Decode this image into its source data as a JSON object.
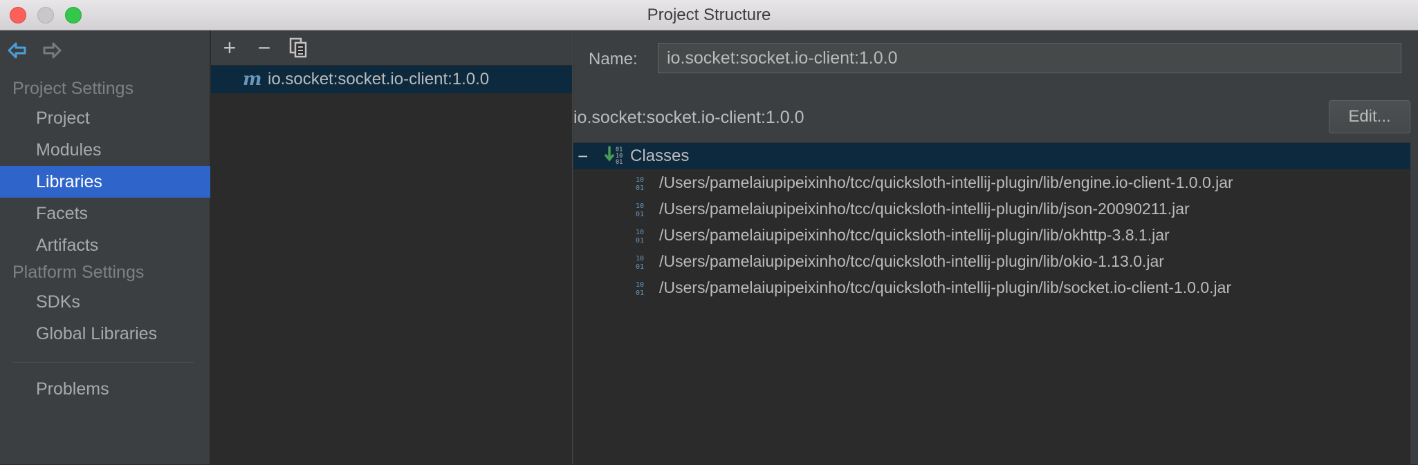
{
  "window": {
    "title": "Project Structure"
  },
  "sidebar": {
    "sections": [
      {
        "header": "Project Settings",
        "items": [
          "Project",
          "Modules",
          "Libraries",
          "Facets",
          "Artifacts"
        ]
      },
      {
        "header": "Platform Settings",
        "items": [
          "SDKs",
          "Global Libraries"
        ]
      }
    ],
    "bottom_item": "Problems",
    "selected": "Libraries"
  },
  "list": {
    "toolbar": {
      "add": "+",
      "remove": "−"
    },
    "items": [
      {
        "icon_letter": "m",
        "label": "io.socket:socket.io-client:1.0.0"
      }
    ]
  },
  "detail": {
    "name_label": "Name:",
    "name_value": "io.socket:socket.io-client:1.0.0",
    "library_title": "io.socket:socket.io-client:1.0.0",
    "edit_label": "Edit...",
    "tree": {
      "collapse_glyph": "−",
      "root_label": "Classes",
      "jars": [
        "/Users/pamelaiupipeixinho/tcc/quicksloth-intellij-plugin/lib/engine.io-client-1.0.0.jar",
        "/Users/pamelaiupipeixinho/tcc/quicksloth-intellij-plugin/lib/json-20090211.jar",
        "/Users/pamelaiupipeixinho/tcc/quicksloth-intellij-plugin/lib/okhttp-3.8.1.jar",
        "/Users/pamelaiupipeixinho/tcc/quicksloth-intellij-plugin/lib/okio-1.13.0.jar",
        "/Users/pamelaiupipeixinho/tcc/quicksloth-intellij-plugin/lib/socket.io-client-1.0.0.jar"
      ]
    }
  },
  "colors": {
    "selection": "#2f65ca",
    "tree_selection": "#0d293e",
    "icon_blue": "#6897bb",
    "arrow_green": "#499c54"
  }
}
